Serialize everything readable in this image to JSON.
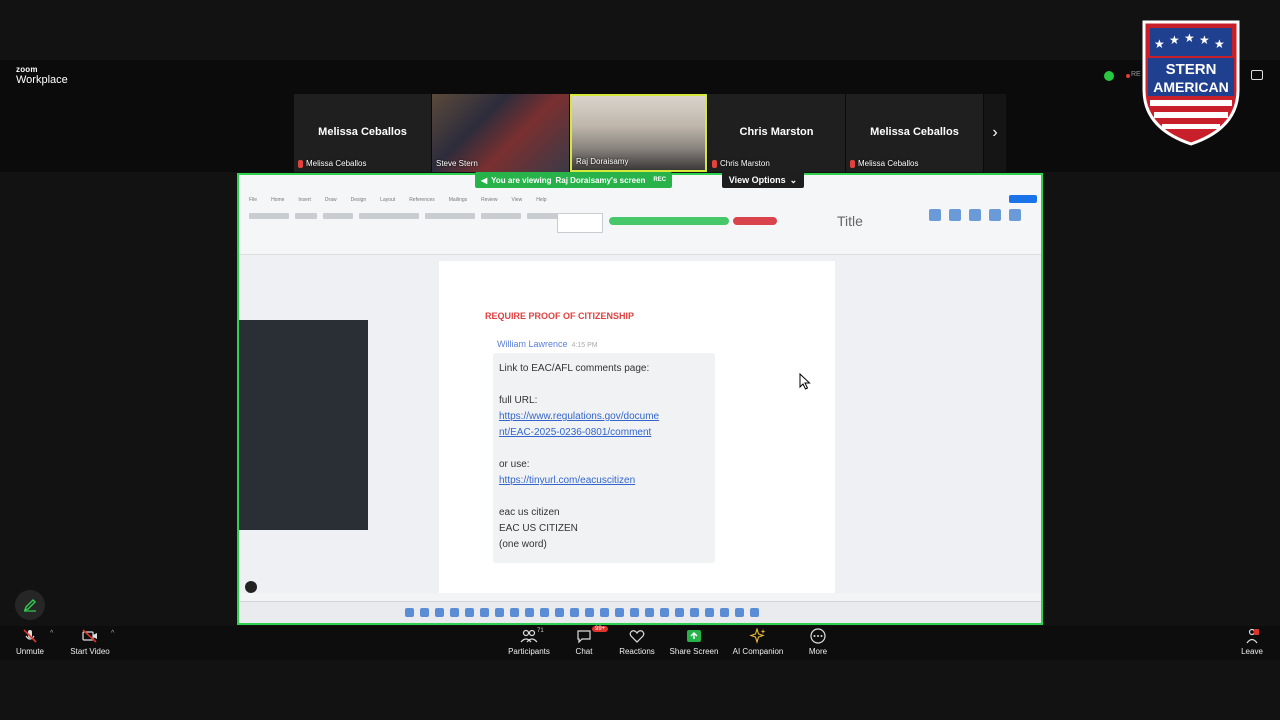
{
  "app": {
    "brand_small": "zoom",
    "brand_name": "Workplace",
    "rec_label": "RE"
  },
  "participants": [
    {
      "name": "Melissa Ceballos",
      "label": "Melissa Ceballos",
      "type": "name"
    },
    {
      "name": "Steve Stern",
      "label": "Steve Stern",
      "type": "video"
    },
    {
      "name": "Raj Doraisamy",
      "label": "Raj Doraisamy",
      "type": "video"
    },
    {
      "name": "Chris Marston",
      "label": "Chris Marston",
      "type": "name"
    },
    {
      "name": "Melissa Ceballos",
      "label": "Melissa Ceballos",
      "type": "name"
    }
  ],
  "share_banner": {
    "text": "You are viewing",
    "owner": "Raj Doraisamy's screen",
    "rec": "REC",
    "view_options": "View Options"
  },
  "logo": {
    "line1": "STERN",
    "line2": "AMERICAN"
  },
  "document": {
    "style_title": "Title",
    "heading": "REQUIRE PROOF OF CITIZENSHIP",
    "comment_author": "William Lawrence",
    "comment_time": "4:15 PM",
    "lines": {
      "intro": "Link to EAC/AFL comments page:",
      "full_url_label": "full URL:",
      "url_part1": "https://www.regulations.gov/docume",
      "url_part2": "nt/EAC-2025-0236-0801/comment",
      "or_use": "or use:",
      "short_url": "https://tinyurl.com/eacuscitizen",
      "c1": "eac us citizen",
      "c2": "EAC US CITIZEN",
      "c3": "(one word)"
    }
  },
  "toolbar": {
    "unmute": "Unmute",
    "start_video": "Start Video",
    "participants": "Participants",
    "participants_count": "71",
    "chat": "Chat",
    "chat_badge": "99+",
    "reactions": "Reactions",
    "share_screen": "Share Screen",
    "ai_companion": "AI Companion",
    "more": "More",
    "leave": "Leave"
  },
  "colors": {
    "accent_green": "#2fcf4f",
    "leave_red": "#e0332b",
    "heading_red": "#e04040"
  }
}
